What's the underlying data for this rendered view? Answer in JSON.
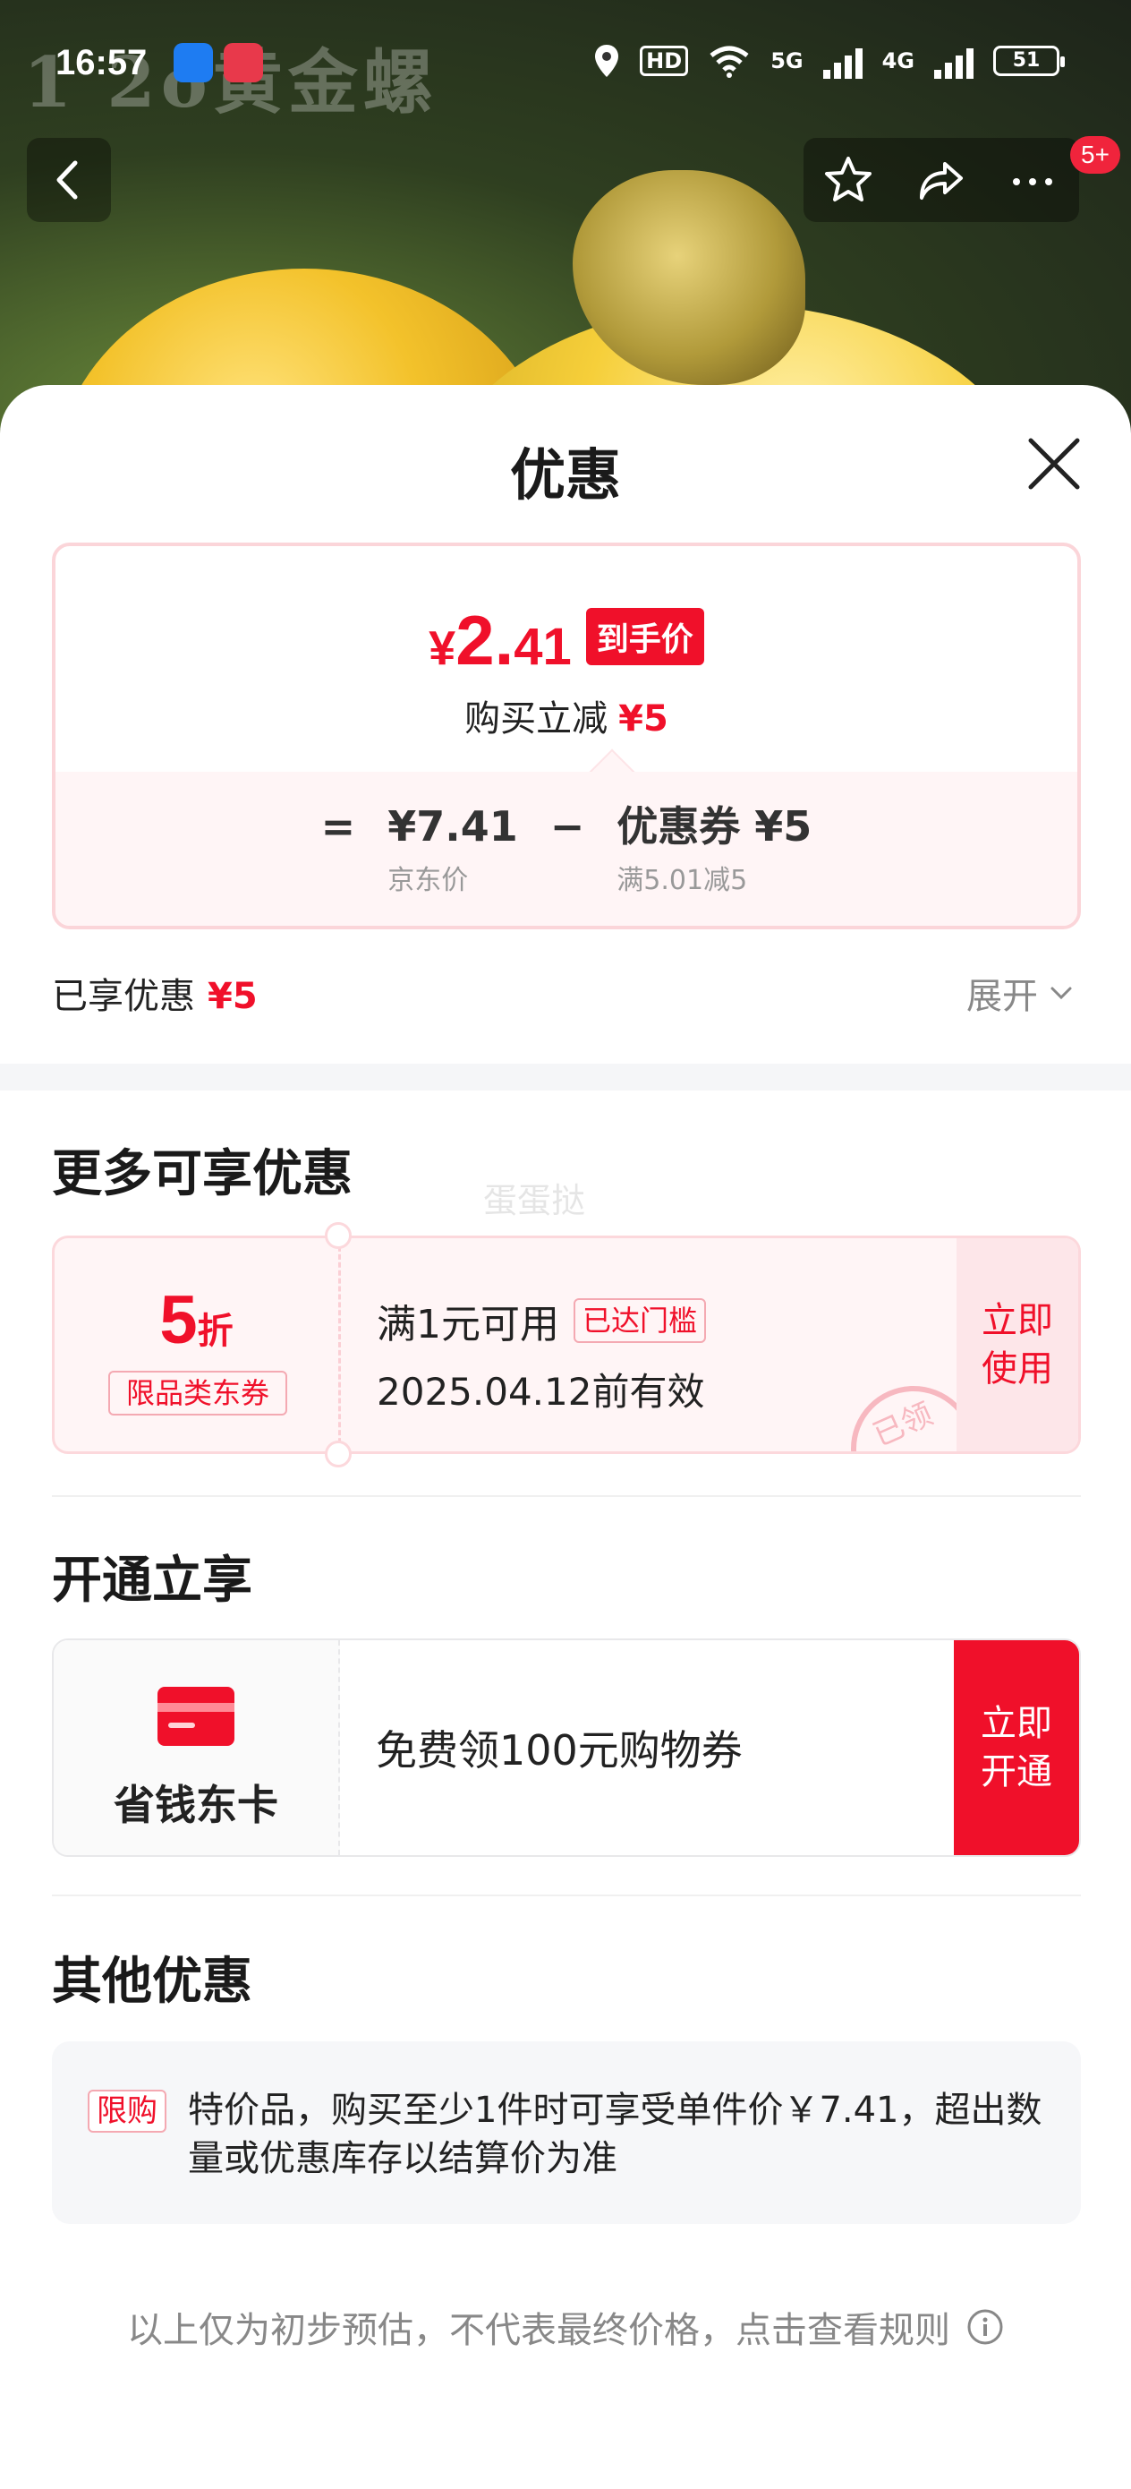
{
  "status_bar": {
    "time": "16:57",
    "hd_label": "HD",
    "net_5g": "5G",
    "net_4g": "4G",
    "battery": "51"
  },
  "hero": {
    "watermark": "1 2o黄金螺",
    "cart_badge": "5+"
  },
  "sheet": {
    "title": "优惠"
  },
  "price_card": {
    "currency": "¥",
    "price_int": "2.",
    "price_dec": "41",
    "final_tag": "到手价",
    "reduce_label": "购买立减",
    "reduce_value": "¥5",
    "equals": "=",
    "minus": "−",
    "base_price": "¥7.41",
    "base_label": "京东价",
    "coupon_value": "优惠券 ¥5",
    "coupon_rule": "满5.01减5"
  },
  "enjoyed": {
    "label": "已享优惠",
    "value": "¥5",
    "expand": "展开"
  },
  "more": {
    "title": "更多可享优惠",
    "watermark": "蛋蛋挞",
    "coupon": {
      "discount": "5",
      "unit": "折",
      "type": "限品类东券",
      "condition": "满1元可用",
      "reached": "已达门槛",
      "valid": "2025.04.12前有效",
      "action": "立即使用",
      "stamp": "已领"
    }
  },
  "activate": {
    "title": "开通立享",
    "card_name": "省钱东卡",
    "benefit": "免费领100元购物券",
    "action": "立即开通"
  },
  "other": {
    "title": "其他优惠",
    "tag": "限购",
    "text": "特价品，购买至少1件时可享受单件价￥7.41，超出数量或优惠库存以结算价为准"
  },
  "footnote": "以上仅为初步预估，不代表最终价格，点击查看规则",
  "colors": {
    "accent": "#f0102a",
    "light_pink": "#fff5f6",
    "border_pink": "#fcd8dc",
    "muted": "#888888"
  }
}
